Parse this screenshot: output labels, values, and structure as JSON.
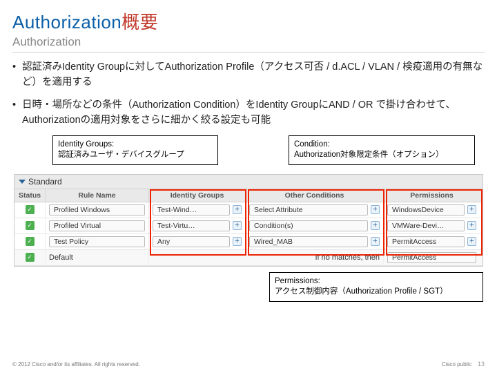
{
  "title_en": "Authorization",
  "title_jp": "概要",
  "subtitle": "Authorization",
  "bullets": [
    "認証済みIdentity Groupに対してAuthorization Profile（アクセス可否 / d.ACL / VLAN / 検疫適用の有無など）を適用する",
    "日時・場所などの条件（Authorization Condition）をIdentity GroupにAND / OR で掛け合わせて、Authorizationの適用対象をさらに細かく絞る設定も可能"
  ],
  "callout_groups": {
    "h": "Identity Groups:",
    "t": "認証済みユーザ・デバイスグループ"
  },
  "callout_cond": {
    "h": "Condition:",
    "t": "Authorization対象限定条件（オプション）"
  },
  "callout_perm": {
    "h": "Permissions:",
    "t": "アクセス制御内容（Authorization Profile / SGT）"
  },
  "panel": {
    "name": "Standard",
    "cols": [
      "Status",
      "Rule Name",
      "Identity Groups",
      "Other Conditions",
      "Permissions"
    ],
    "rows": [
      {
        "rule": "Profiled Windows",
        "group": "Test-Wind…",
        "cond": "Select Attribute",
        "perm": "WindowsDevice"
      },
      {
        "rule": "Profiled Virtual",
        "group": "Test-Virtu…",
        "cond": "Condition(s)",
        "perm": "VMWare-Devi…"
      },
      {
        "rule": "Test Policy",
        "group": "Any",
        "cond": "Wired_MAB",
        "perm": "PermitAccess"
      }
    ],
    "footer_label": "Default",
    "footer_text": "If no matches, then",
    "footer_perm": "PermitAccess"
  },
  "footer": {
    "left": "© 2012 Cisco and/or its affiliates. All rights reserved.",
    "right": "Cisco public",
    "page": "13"
  }
}
